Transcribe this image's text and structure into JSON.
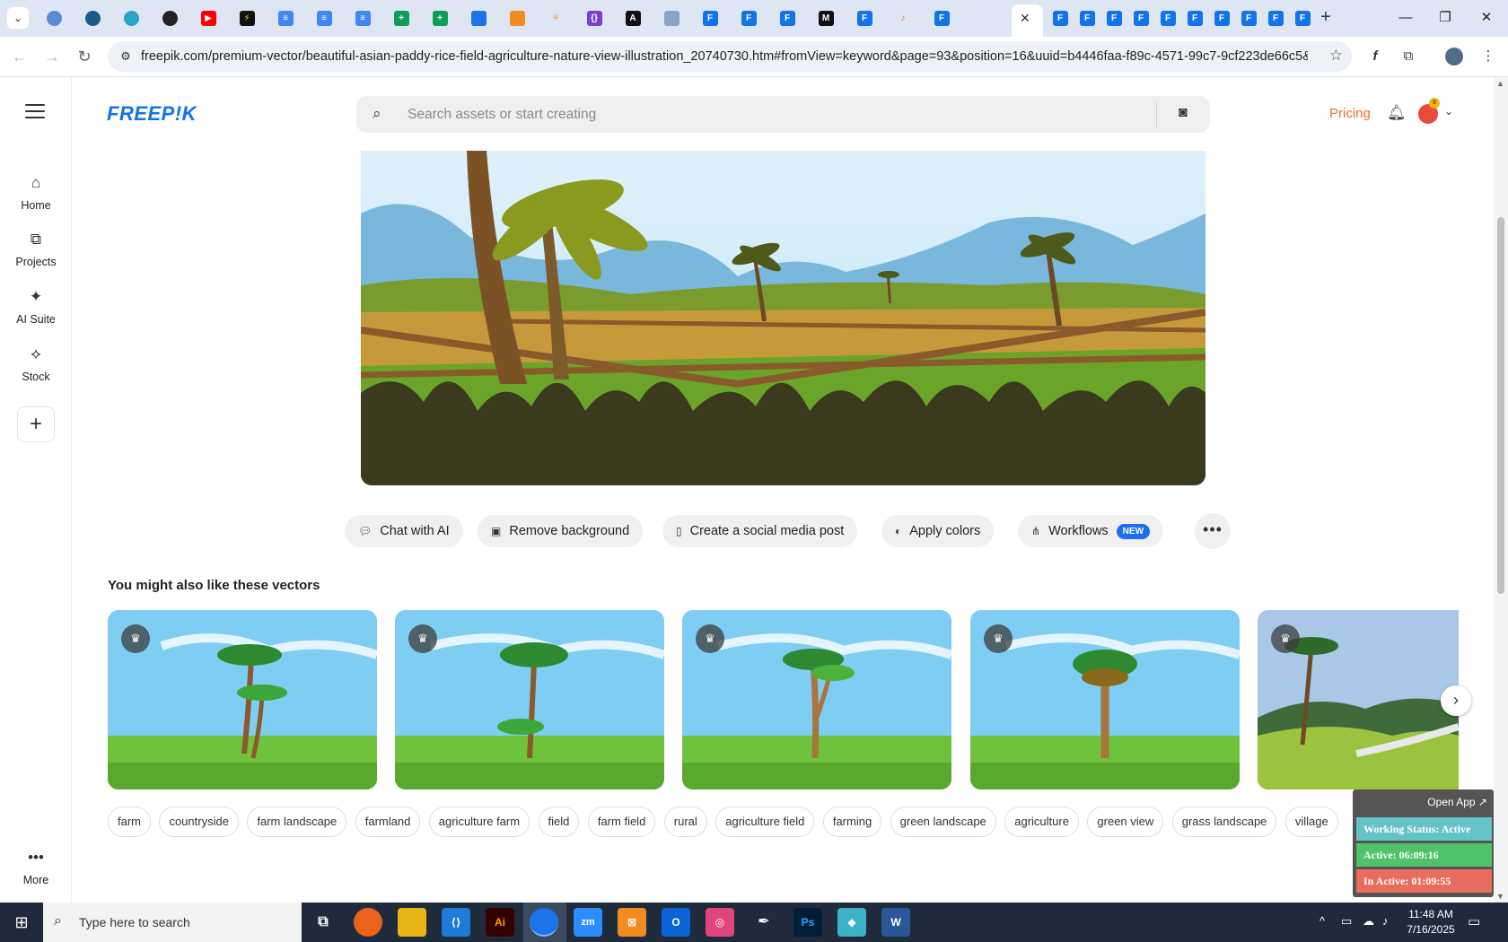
{
  "browser": {
    "url": "freepik.com/premium-vector/beautiful-asian-paddy-rice-field-agriculture-nature-view-illustration_20740730.htm#fromView=keyword&page=93&position=16&uuid=b4446faa-f89c-4571-99c7-9cf223de66c5&...",
    "tab_close": "✕",
    "new_tab": "+"
  },
  "header": {
    "logo": "FREEP!K",
    "search_placeholder": "Search assets or start creating",
    "pricing": "Pricing"
  },
  "sidebar": {
    "items": [
      {
        "label": "Home",
        "icon": "home-icon"
      },
      {
        "label": "Projects",
        "icon": "projects-icon"
      },
      {
        "label": "AI Suite",
        "icon": "ai-suite-icon"
      },
      {
        "label": "Stock",
        "icon": "stock-icon"
      }
    ],
    "more": "More"
  },
  "actions": {
    "chat": "Chat with AI",
    "remove_bg": "Remove background",
    "social": "Create a social media post",
    "colors": "Apply colors",
    "workflows": "Workflows",
    "new_badge": "NEW"
  },
  "related": {
    "title": "You might also like these vectors"
  },
  "tags": [
    "farm",
    "countryside",
    "farm landscape",
    "farmland",
    "agriculture farm",
    "field",
    "farm field",
    "rural",
    "agriculture field",
    "farming",
    "green landscape",
    "agriculture",
    "green view",
    "grass landscape",
    "village"
  ],
  "widget": {
    "open_app": "Open App ↗",
    "status": "Working Status: Active",
    "active": "Active: 06:09:16",
    "inactive": "In Active: 01:09:55",
    "colors": {
      "status": "#63c3c9",
      "active": "#4fc26a",
      "inactive": "#e86d5e"
    }
  },
  "taskbar": {
    "search_placeholder": "Type here to search",
    "time": "11:48 AM",
    "date": "7/16/2025"
  },
  "colors": {
    "brand": "#1273eb",
    "pricing": "#e8702a"
  }
}
